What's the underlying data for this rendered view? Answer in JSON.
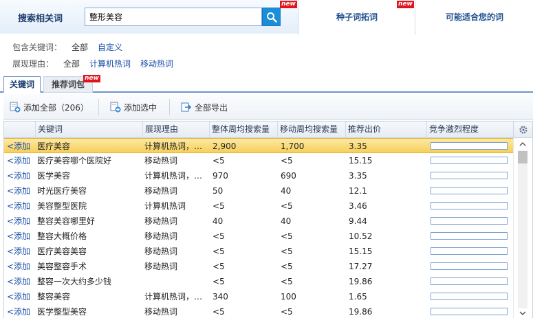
{
  "search": {
    "label": "搜索相关词",
    "value": "整形美容",
    "new_badge": "new"
  },
  "top_tabs": [
    {
      "label": "种子词拓词",
      "badge": "new"
    },
    {
      "label": "可能适合您的词"
    }
  ],
  "filters": {
    "include_label": "包含关键词：",
    "include_all": "全部",
    "include_custom": "自定义",
    "reason_label": "展现理由：",
    "reason_all": "全部",
    "reason_pc": "计算机热词",
    "reason_mobile": "移动热词"
  },
  "tabs": [
    {
      "label": "关键词"
    },
    {
      "label": "推荐词包",
      "badge": "new"
    }
  ],
  "toolbar": {
    "add_all": "添加全部（206）",
    "add_selected": "添加选中",
    "export_all": "全部导出"
  },
  "table": {
    "headers": [
      "关键词",
      "展现理由",
      "整体周均搜索量",
      "移动周均搜索量",
      "推荐出价",
      "竞争激烈程度"
    ],
    "add_label": "<添加",
    "rows": [
      {
        "keyword": "医疗美容",
        "reason": "计算机热词，…",
        "overall": "2,900",
        "mobile": "1,700",
        "bid": "3.35",
        "competition": 0.0
      },
      {
        "keyword": "医疗美容哪个医院好",
        "reason": "移动热词",
        "overall": "<5",
        "mobile": "<5",
        "bid": "15.15",
        "competition": 0.0
      },
      {
        "keyword": "医学美容",
        "reason": "计算机热词，…",
        "overall": "970",
        "mobile": "690",
        "bid": "3.35",
        "competition": 0.0
      },
      {
        "keyword": "时光医疗美容",
        "reason": "移动热词",
        "overall": "50",
        "mobile": "40",
        "bid": "12.1",
        "competition": 0.0
      },
      {
        "keyword": "美容整型医院",
        "reason": "计算机热词",
        "overall": "<5",
        "mobile": "<5",
        "bid": "3.46",
        "competition": 0.0
      },
      {
        "keyword": "整容美容哪里好",
        "reason": "移动热词",
        "overall": "40",
        "mobile": "40",
        "bid": "9.44",
        "competition": 0.0
      },
      {
        "keyword": "整容大概价格",
        "reason": "移动热词",
        "overall": "<5",
        "mobile": "<5",
        "bid": "10.52",
        "competition": 0.0
      },
      {
        "keyword": "医疗美容美容",
        "reason": "移动热词",
        "overall": "<5",
        "mobile": "<5",
        "bid": "15.15",
        "competition": 0.0
      },
      {
        "keyword": "美容整容手术",
        "reason": "移动热词",
        "overall": "<5",
        "mobile": "<5",
        "bid": "17.27",
        "competition": 0.0
      },
      {
        "keyword": "整容一次大约多少钱",
        "reason": "",
        "overall": "<5",
        "mobile": "<5",
        "bid": "19.86",
        "competition": 0.0
      },
      {
        "keyword": "整容美容",
        "reason": "计算机热词，…",
        "overall": "340",
        "mobile": "100",
        "bid": "1.65",
        "competition": 0.0
      },
      {
        "keyword": "医学整型美容",
        "reason": "移动热词",
        "overall": "<5",
        "mobile": "<5",
        "bid": "19.86",
        "competition": 0.0
      }
    ]
  },
  "colors": {
    "accent": "#1a8fd8",
    "link": "#1a4fa8",
    "selected_row": "#f7cf58",
    "badge": "#e0141e"
  }
}
